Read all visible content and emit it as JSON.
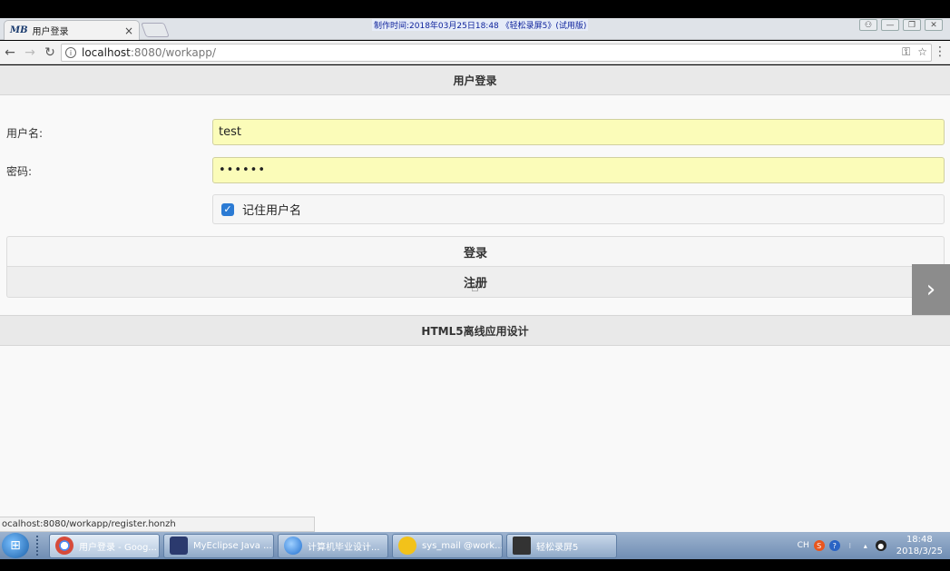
{
  "browser": {
    "tab_favicon": "MB",
    "tab_title": "用户登录",
    "tab_close": "×",
    "watermark": "制作时间:2018年03月25日18:48 《轻松录屏5》(试用版)",
    "url_host": "localhost",
    "url_rest": ":8080/workapp/",
    "status_url": "ocalhost:8080/workapp/register.honzh",
    "icons": {
      "back": "arrow-left-icon",
      "forward": "arrow-right-icon",
      "reload": "reload-icon",
      "info": "info-icon",
      "key": "key-icon",
      "star": "star-icon",
      "menu": "menu-dots-icon"
    }
  },
  "page": {
    "header_title": "用户登录",
    "username_label": "用户名:",
    "username_value": "test",
    "password_label": "密码:",
    "password_value": "••••••",
    "remember_label": "记住用户名",
    "remember_checked": true,
    "login_button": "登录",
    "register_button": "注册",
    "footer_title": "HTML5离线应用设计",
    "next_arrow": "›"
  },
  "taskbar": {
    "tasks": [
      {
        "label": "用户登录 - Goog...",
        "icon": "chrome-icon",
        "color": "#d64a3a"
      },
      {
        "label": "MyEclipse Java ...",
        "icon": "myeclipse-icon",
        "color": "#2b3a6e"
      },
      {
        "label": "计算机毕业设计...",
        "icon": "globe-icon",
        "color": "#1f6fd0"
      },
      {
        "label": "sys_mail @work...",
        "icon": "yellow-chick-icon",
        "color": "#f2c21a"
      },
      {
        "label": "轻松录屏5",
        "icon": "recorder-icon",
        "color": "#333333"
      }
    ],
    "tray_lang": "CH",
    "clock_time": "18:48",
    "clock_date": "2018/3/25"
  }
}
